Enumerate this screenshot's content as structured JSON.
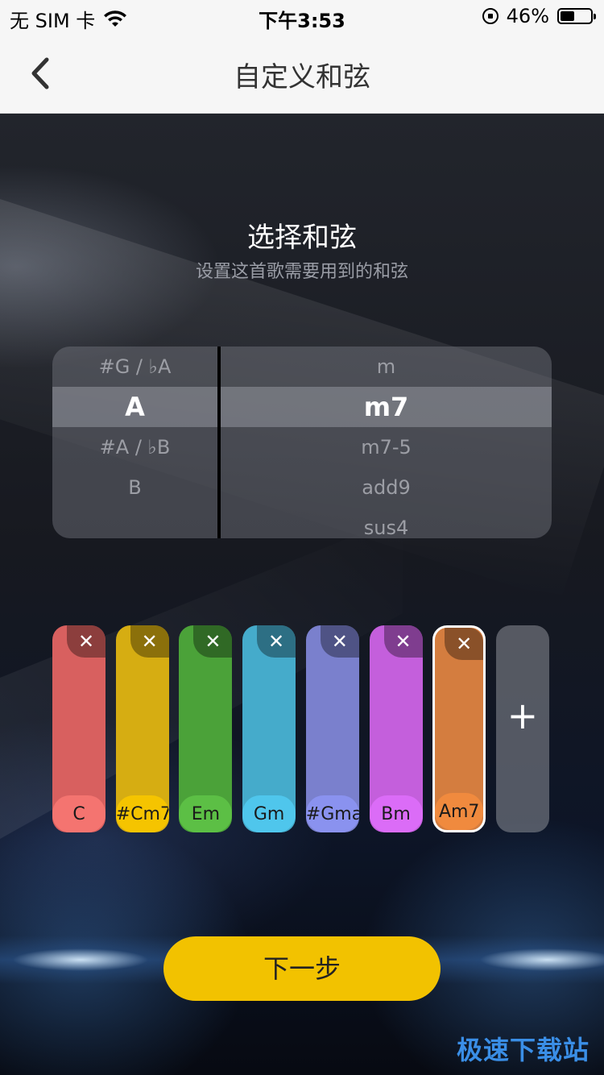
{
  "status": {
    "carrier": "无 SIM 卡",
    "time": "下午3:53",
    "battery": "46%",
    "battery_level": 0.46
  },
  "nav": {
    "title": "自定义和弦"
  },
  "section": {
    "title": "选择和弦",
    "subtitle": "设置这首歌需要用到的和弦"
  },
  "picker": {
    "roots": [
      "#G / ♭A",
      "A",
      "#A / ♭B",
      "B",
      ""
    ],
    "qualities": [
      "m",
      "m7",
      "m7-5",
      "add9",
      "sus4"
    ],
    "selected_root": "A",
    "selected_quality": "m7"
  },
  "chords": [
    {
      "label": "C",
      "color": "#d8605f",
      "label_color": "#f47470"
    },
    {
      "label": "#Cm7",
      "color": "#d6ad12",
      "label_color": "#f5c400"
    },
    {
      "label": "Em",
      "color": "#4ba239",
      "label_color": "#5cbf45"
    },
    {
      "label": "Gm",
      "color": "#45abcb",
      "label_color": "#4fc6ec"
    },
    {
      "label": "#Gma",
      "color": "#7a80cd",
      "label_color": "#8a92ef"
    },
    {
      "label": "Bm",
      "color": "#c45fdc",
      "label_color": "#db6cf7"
    },
    {
      "label": "Am7",
      "color": "#d47d3f",
      "label_color": "#f08a3e",
      "active": true
    }
  ],
  "remove_symbol": "✕",
  "add_symbol": "+",
  "next_label": "下一步",
  "watermark": "极速下载站",
  "colors": {
    "accent": "#f2c200",
    "nav_bg": "#f6f6f6"
  }
}
